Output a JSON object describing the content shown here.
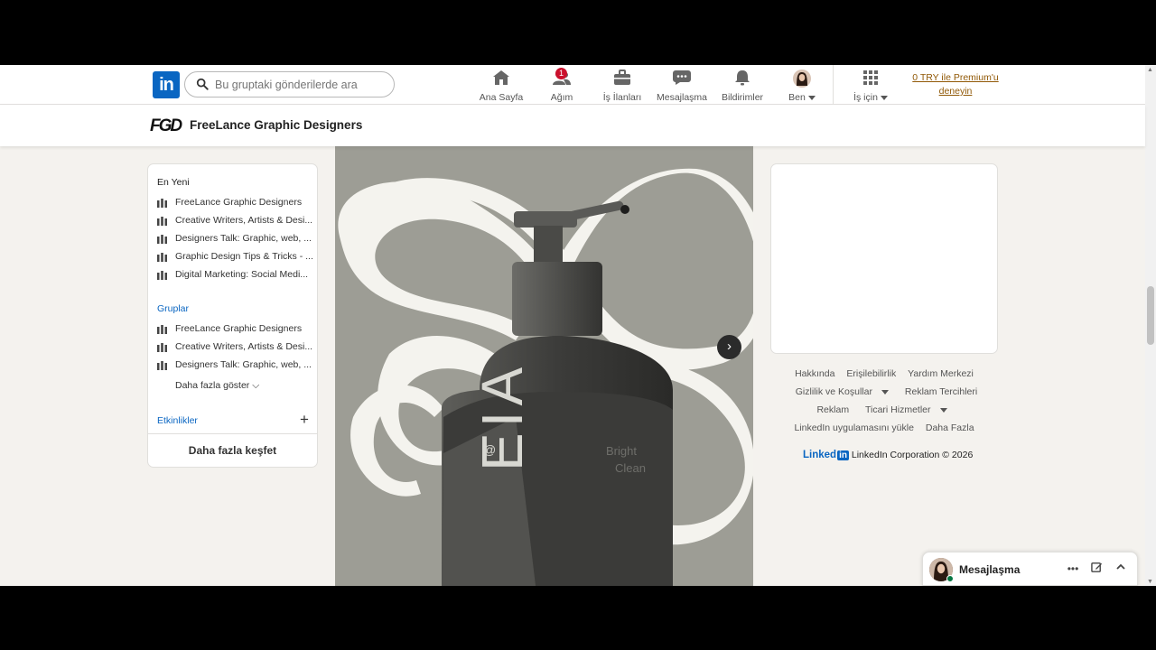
{
  "nav": {
    "search_placeholder": "Bu gruptaki gönderilerde ara",
    "items": [
      {
        "label": "Ana Sayfa",
        "icon": "home-icon"
      },
      {
        "label": "Ağım",
        "icon": "network-icon",
        "badge": "1"
      },
      {
        "label": "İş İlanları",
        "icon": "briefcase-icon"
      },
      {
        "label": "Mesajlaşma",
        "icon": "messaging-icon"
      },
      {
        "label": "Bildirimler",
        "icon": "bell-icon"
      },
      {
        "label": "Ben",
        "icon": "avatar"
      },
      {
        "label": "İş için",
        "icon": "grid-icon"
      }
    ],
    "premium_line1": "0 TRY ile Premium'u",
    "premium_line2": "deneyin"
  },
  "group": {
    "logo_text": "FGD",
    "title": "FreeLance Graphic Designers"
  },
  "sidebar": {
    "recent_title": "En Yeni",
    "recent": [
      "FreeLance Graphic Designers",
      "Creative Writers, Artists & Desi...",
      "Designers Talk: Graphic, web, ...",
      "Graphic Design Tips & Tricks - ...",
      "Digital Marketing: Social Medi..."
    ],
    "groups_title": "Gruplar",
    "groups": [
      "FreeLance Graphic Designers",
      "Creative Writers, Artists & Desi...",
      "Designers Talk: Graphic, web, ..."
    ],
    "show_more": "Daha fazla göster",
    "events_title": "Etkinlikler",
    "discover": "Daha fazla keşfet"
  },
  "post_image": {
    "text_vertical": "EIA",
    "text_at": "@",
    "text_line1": "Bright",
    "text_line2": "Clean"
  },
  "footer": {
    "links_row1": [
      "Hakkında",
      "Erişilebilirlik",
      "Yardım Merkezi"
    ],
    "links_row2": [
      "Gizlilik ve Koşullar",
      "Reklam Tercihleri"
    ],
    "links_row3": [
      "Reklam",
      "Ticari Hizmetler"
    ],
    "links_row4": [
      "LinkedIn uygulamasını yükle",
      "Daha Fazla"
    ],
    "brand": "Linked",
    "brand_in": "in",
    "copyright": "LinkedIn Corporation © 2026"
  },
  "messaging": {
    "title": "Mesajlaşma"
  },
  "colors": {
    "accent": "#0a66c2",
    "premium": "#915907",
    "badge": "#cb112d"
  }
}
